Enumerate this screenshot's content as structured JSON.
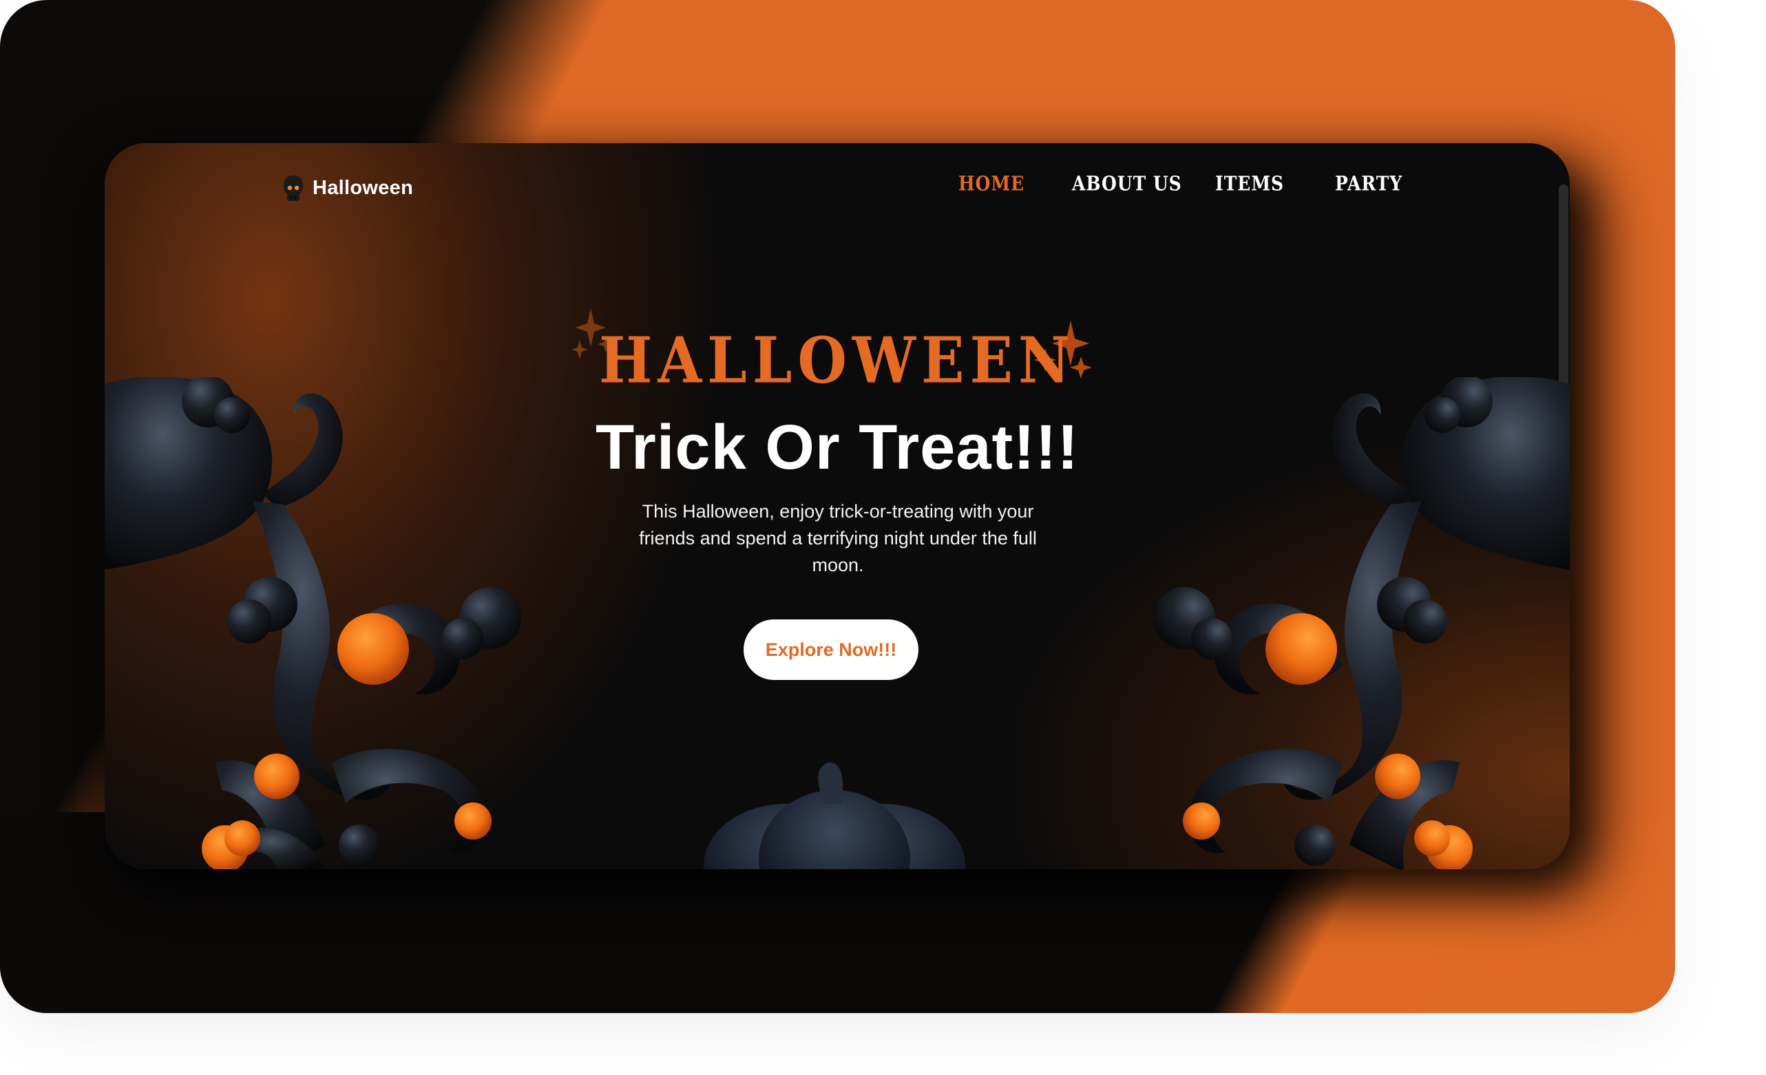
{
  "brand": {
    "name": "Halloween",
    "icon": "skull-icon"
  },
  "nav": {
    "items": [
      {
        "label": "HOME",
        "active": true
      },
      {
        "label": "ABOUT US",
        "active": false
      },
      {
        "label": "ITEMS",
        "active": false
      },
      {
        "label": "PARTY",
        "active": false
      }
    ]
  },
  "hero": {
    "title": "HALLOWEEN",
    "heading": "Trick Or Treat!!!",
    "subtitle": "This Halloween, enjoy trick-or-treating with your friends and spend a terrifying night under the full moon.",
    "cta_label": "Explore Now!!!"
  },
  "colors": {
    "accent": "#E06A26",
    "background": "#0C0B0B",
    "text": "#FFFFFF",
    "outer_orange": "#DE6926"
  },
  "decorations": {
    "left": "tentacle-ornament-with-orange-orbs",
    "right": "tentacle-ornament-with-orange-orbs",
    "bottom": "pumpkin-silhouette",
    "sparkles": "star-sparkle-icon"
  }
}
